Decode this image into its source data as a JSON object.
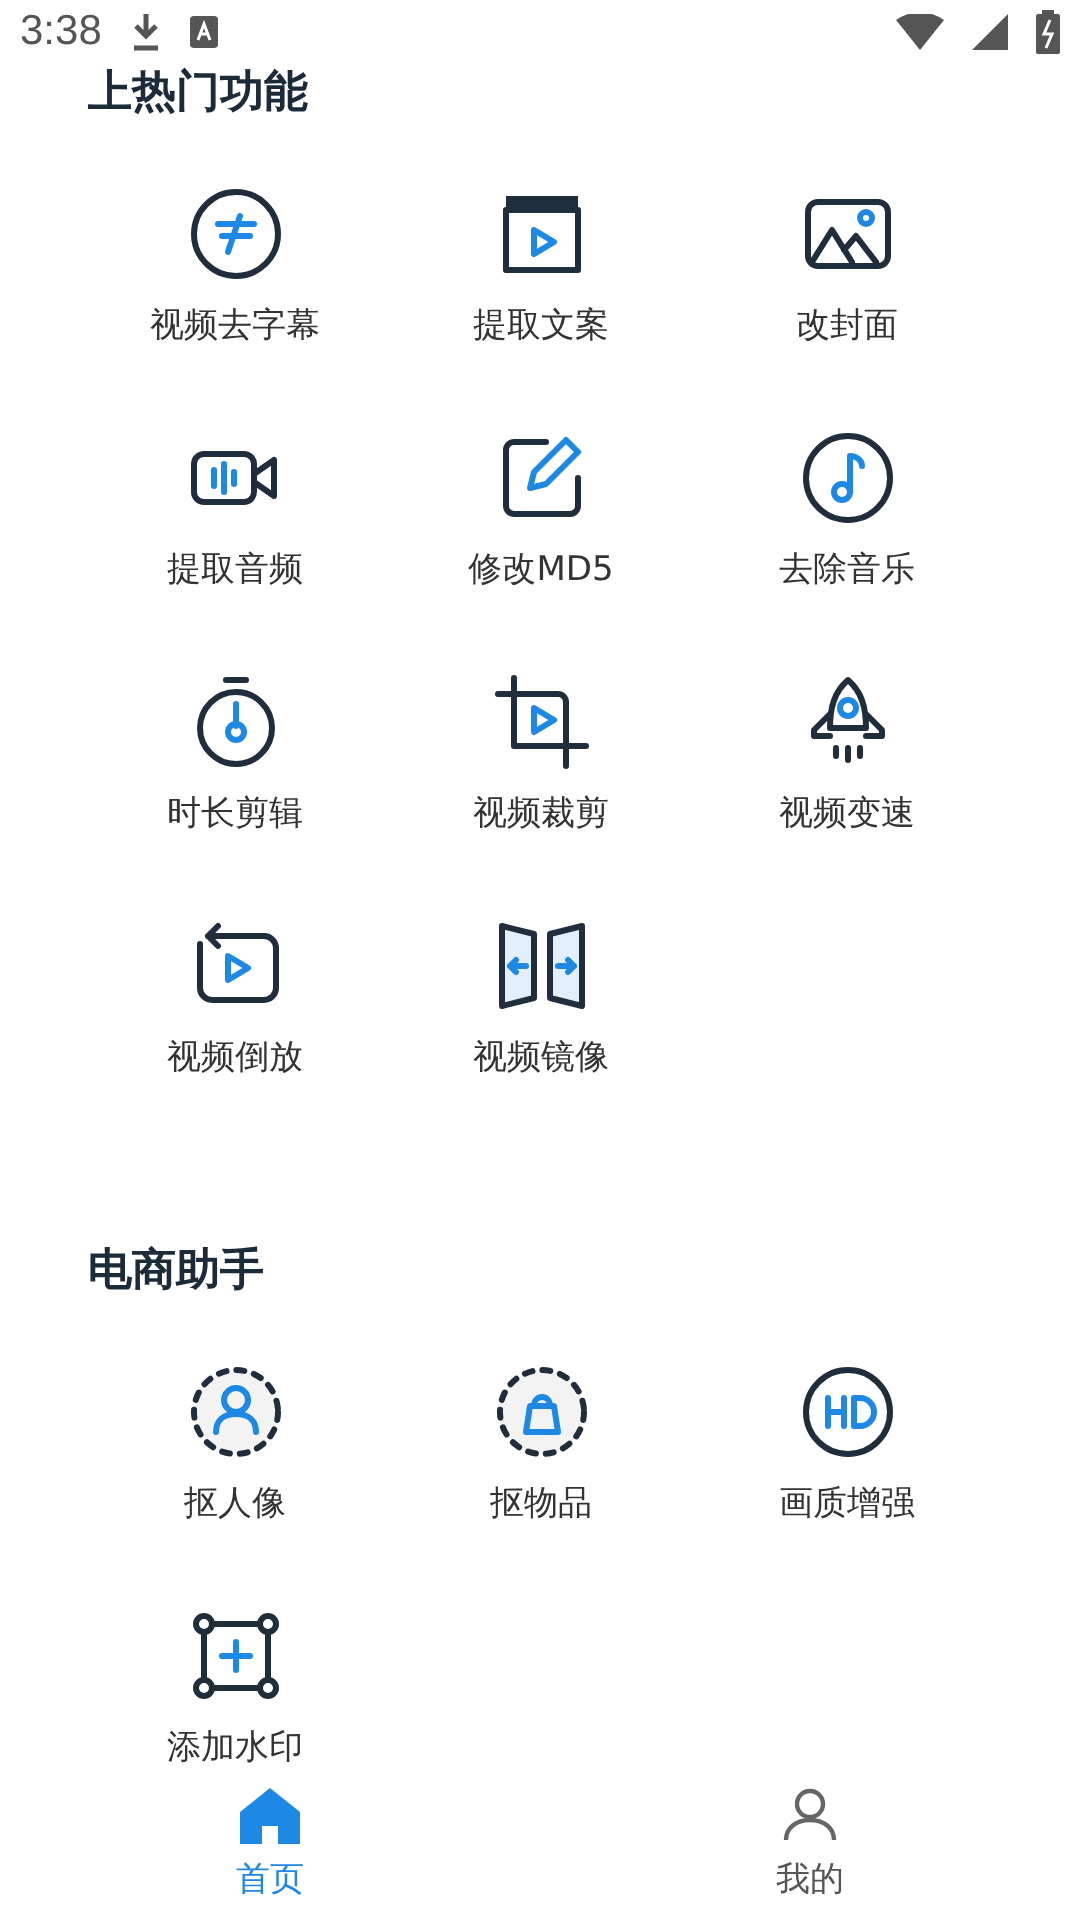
{
  "status_bar": {
    "time": "3:38"
  },
  "sections": [
    {
      "title": "上热门功能",
      "items": [
        {
          "label": "视频去字幕"
        },
        {
          "label": "提取文案"
        },
        {
          "label": "改封面"
        },
        {
          "label": "提取音频"
        },
        {
          "label": "修改MD5"
        },
        {
          "label": "去除音乐"
        },
        {
          "label": "时长剪辑"
        },
        {
          "label": "视频裁剪"
        },
        {
          "label": "视频变速"
        },
        {
          "label": "视频倒放"
        },
        {
          "label": "视频镜像"
        }
      ]
    },
    {
      "title": "电商助手",
      "items": [
        {
          "label": "抠人像"
        },
        {
          "label": "抠物品"
        },
        {
          "label": "画质增强"
        },
        {
          "label": "添加水印"
        }
      ]
    }
  ],
  "tabs": [
    {
      "label": "首页",
      "selected": true
    },
    {
      "label": "我的",
      "selected": false
    }
  ]
}
